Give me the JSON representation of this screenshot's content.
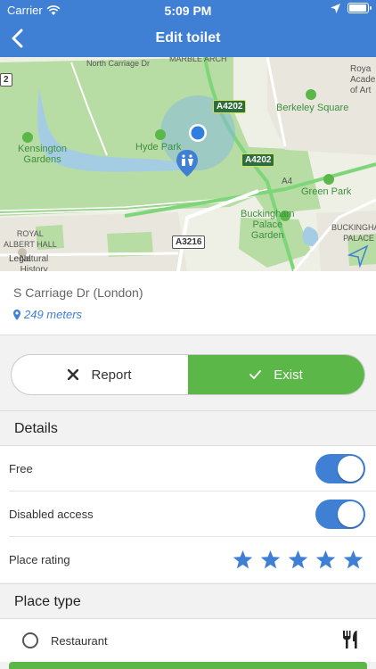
{
  "status": {
    "carrier": "Carrier",
    "time": "5:09 PM"
  },
  "nav": {
    "title": "Edit toilet"
  },
  "map": {
    "labels": {
      "north_carriage": "North Carriage Dr",
      "kensington": "Kensington\nGardens",
      "hyde_park": "Hyde Park",
      "berkeley": "Berkeley Square",
      "green_park": "Green Park",
      "buckingham_garden": "Buckingham\nPalace\nGarden",
      "buckingham_palace": "BUCKINGHAM\nPALACE",
      "royal_albert": "ROYAL\nALBERT HALL",
      "natural_history": "Natural\nHistory",
      "royal_academy": "Roya\nAcadem\nof Art",
      "a4202_top": "A4202",
      "a4202_mid": "A4202",
      "a3216": "A3216",
      "a4": "A4",
      "marble_arch": "MARBLE ARCH",
      "box2": "2",
      "legal": "Legal"
    }
  },
  "place": {
    "street": "S Carriage Dr (London)",
    "distance": "249 meters"
  },
  "actions": {
    "report_label": "Report",
    "exist_label": "Exist"
  },
  "details": {
    "header": "Details",
    "free_label": "Free",
    "free_on": true,
    "disabled_label": "Disabled access",
    "disabled_on": true,
    "rating_label": "Place rating",
    "rating": 5
  },
  "place_type": {
    "header": "Place type",
    "option_label": "Restaurant"
  },
  "colors": {
    "accent": "#3f7fd4",
    "green": "#5bb848"
  }
}
